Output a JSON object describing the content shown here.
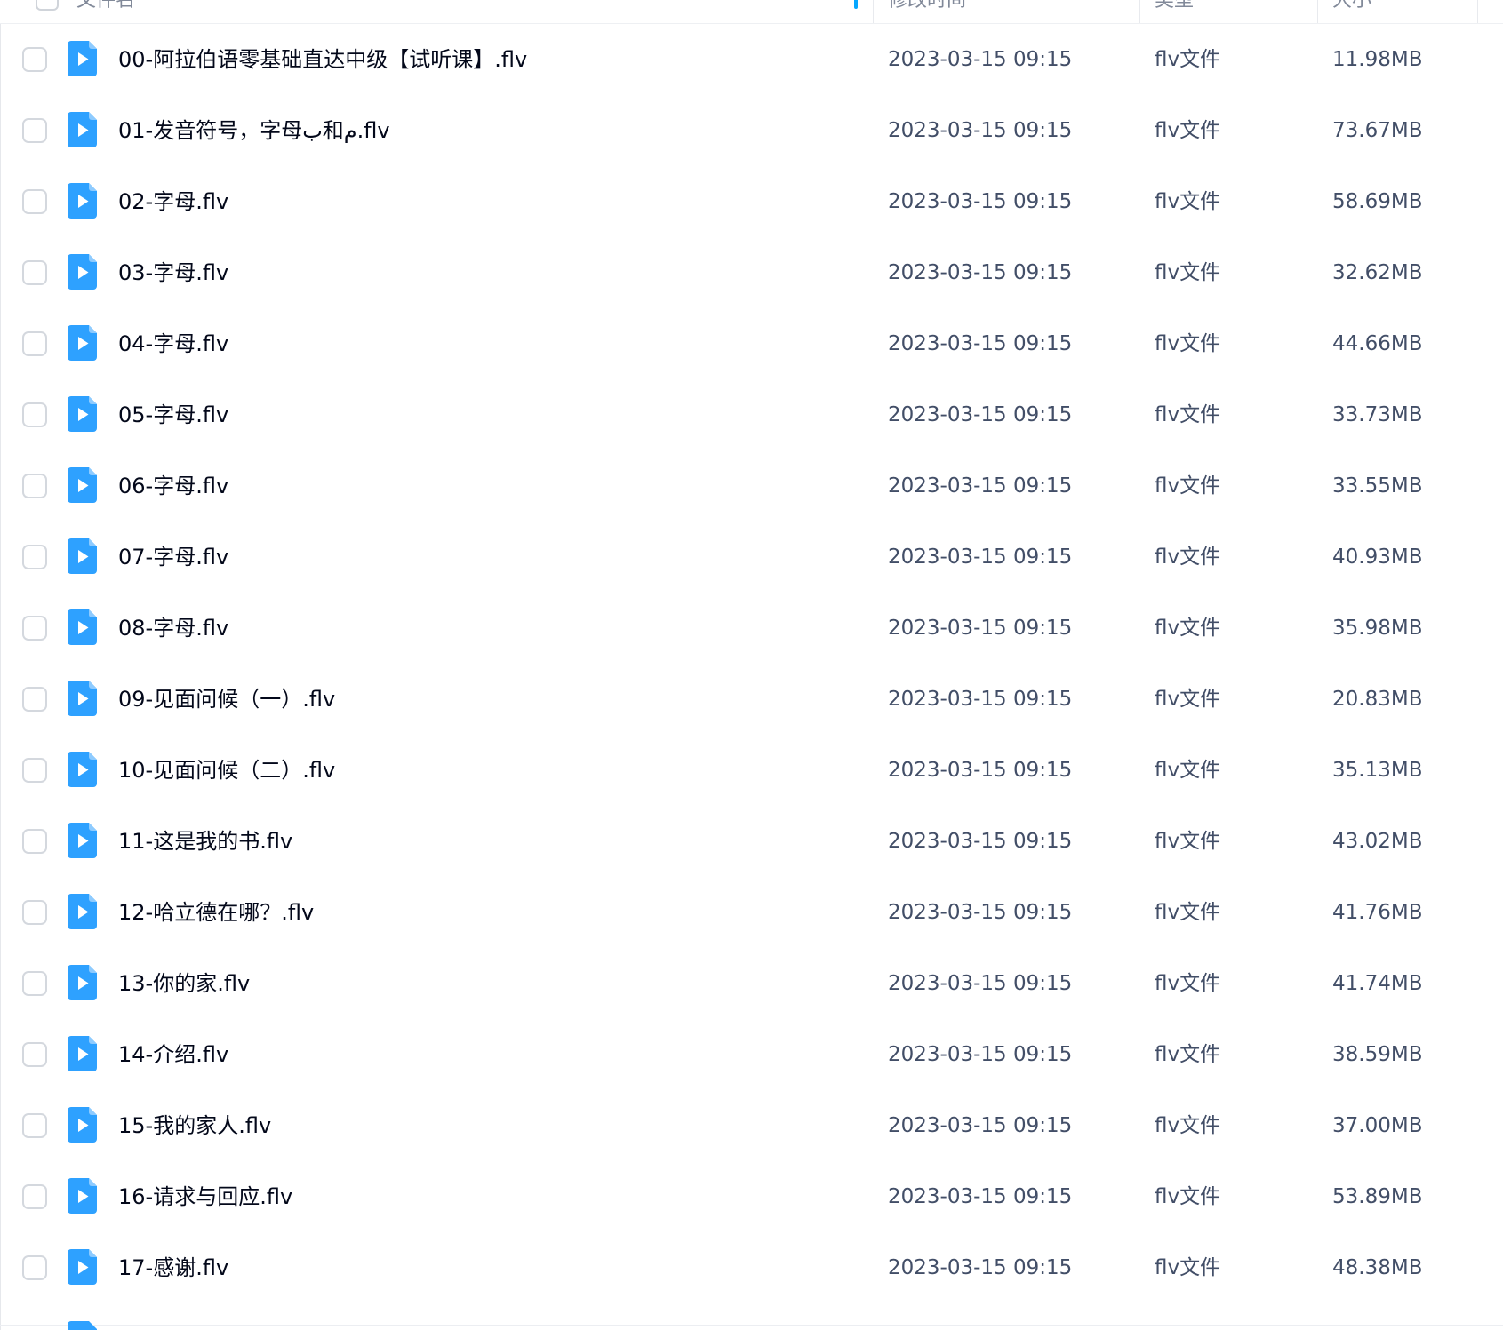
{
  "header": {
    "col_name": "文件名",
    "col_modified": "修改时间",
    "col_type": "类型",
    "col_size": "大小"
  },
  "colors": {
    "accent": "#06a7ff",
    "icon_blue": "#2ea1ff"
  },
  "file_icon": "video-file-icon",
  "files": [
    {
      "name": "00-阿拉伯语零基础直达中级【试听课】.flv",
      "modified": "2023-03-15 09:15",
      "type": "flv文件",
      "size": "11.98MB"
    },
    {
      "name": "01-发音符号，字母ب和م.flv",
      "modified": "2023-03-15 09:15",
      "type": "flv文件",
      "size": "73.67MB"
    },
    {
      "name": "02-字母.flv",
      "modified": "2023-03-15 09:15",
      "type": "flv文件",
      "size": "58.69MB"
    },
    {
      "name": "03-字母.flv",
      "modified": "2023-03-15 09:15",
      "type": "flv文件",
      "size": "32.62MB"
    },
    {
      "name": "04-字母.flv",
      "modified": "2023-03-15 09:15",
      "type": "flv文件",
      "size": "44.66MB"
    },
    {
      "name": "05-字母.flv",
      "modified": "2023-03-15 09:15",
      "type": "flv文件",
      "size": "33.73MB"
    },
    {
      "name": "06-字母.flv",
      "modified": "2023-03-15 09:15",
      "type": "flv文件",
      "size": "33.55MB"
    },
    {
      "name": "07-字母.flv",
      "modified": "2023-03-15 09:15",
      "type": "flv文件",
      "size": "40.93MB"
    },
    {
      "name": "08-字母.flv",
      "modified": "2023-03-15 09:15",
      "type": "flv文件",
      "size": "35.98MB"
    },
    {
      "name": "09-见面问候（一）.flv",
      "modified": "2023-03-15 09:15",
      "type": "flv文件",
      "size": "20.83MB"
    },
    {
      "name": "10-见面问候（二）.flv",
      "modified": "2023-03-15 09:15",
      "type": "flv文件",
      "size": "35.13MB"
    },
    {
      "name": "11-这是我的书.flv",
      "modified": "2023-03-15 09:15",
      "type": "flv文件",
      "size": "43.02MB"
    },
    {
      "name": "12-哈立德在哪？.flv",
      "modified": "2023-03-15 09:15",
      "type": "flv文件",
      "size": "41.76MB"
    },
    {
      "name": "13-你的家.flv",
      "modified": "2023-03-15 09:15",
      "type": "flv文件",
      "size": "41.74MB"
    },
    {
      "name": "14-介绍.flv",
      "modified": "2023-03-15 09:15",
      "type": "flv文件",
      "size": "38.59MB"
    },
    {
      "name": "15-我的家人.flv",
      "modified": "2023-03-15 09:15",
      "type": "flv文件",
      "size": "37.00MB"
    },
    {
      "name": "16-请求与回应.flv",
      "modified": "2023-03-15 09:15",
      "type": "flv文件",
      "size": "53.89MB"
    },
    {
      "name": "17-感谢.flv",
      "modified": "2023-03-15 09:15",
      "type": "flv文件",
      "size": "48.38MB"
    }
  ]
}
